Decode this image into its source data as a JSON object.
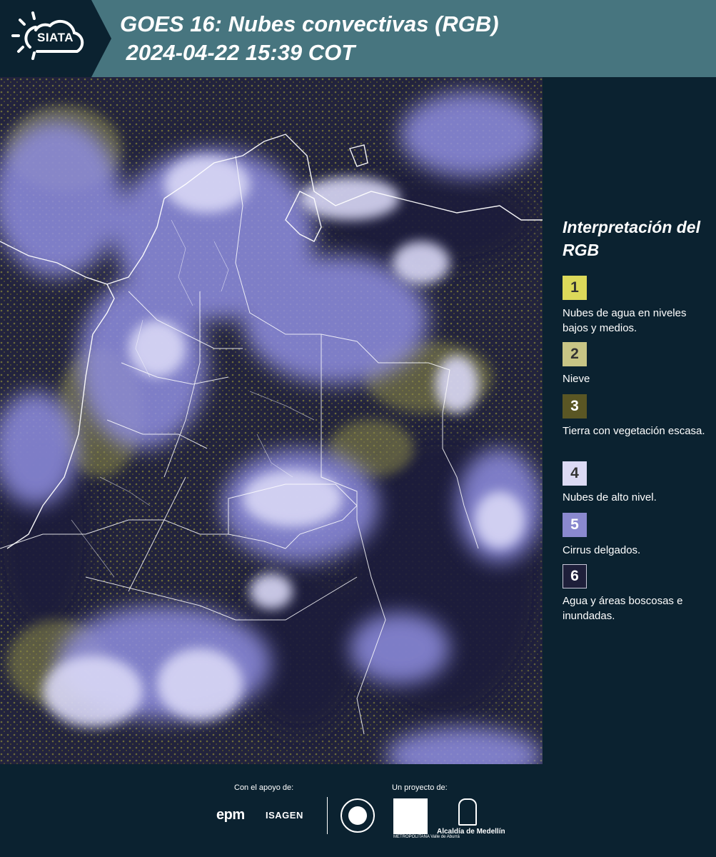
{
  "header": {
    "logo_text": "SIATA",
    "title": "GOES 16: Nubes convectivas (RGB)\n 2024-04-22 15:39 COT"
  },
  "map": {
    "description_icon": "satellite-rgb-image"
  },
  "legend": {
    "title": "Interpretación del RGB",
    "items": [
      {
        "number": "1",
        "color": "#dcd95a",
        "label": "Nubes de agua en niveles bajos y medios."
      },
      {
        "number": "2",
        "color": "#c8c585",
        "label": "Nieve"
      },
      {
        "number": "3",
        "color": "#5a5624",
        "label": "Tierra con vegetación escasa."
      },
      {
        "number": "4",
        "color": "#dcdaf4",
        "label": "Nubes de alto nivel."
      },
      {
        "number": "5",
        "color": "#8a89cf",
        "label": "Cirrus delgados."
      },
      {
        "number": "6",
        "color": "#1e1f3a",
        "label": "Agua y áreas boscosas e inundadas."
      }
    ]
  },
  "footer": {
    "support_label": "Con el apoyo de:",
    "project_label": "Un proyecto de:",
    "epm": "epm",
    "isagen": "ISAGEN",
    "area_label": "METROPOLITANA Valle de Aburrá",
    "alcaldia": "Alcaldía de Medellín"
  }
}
